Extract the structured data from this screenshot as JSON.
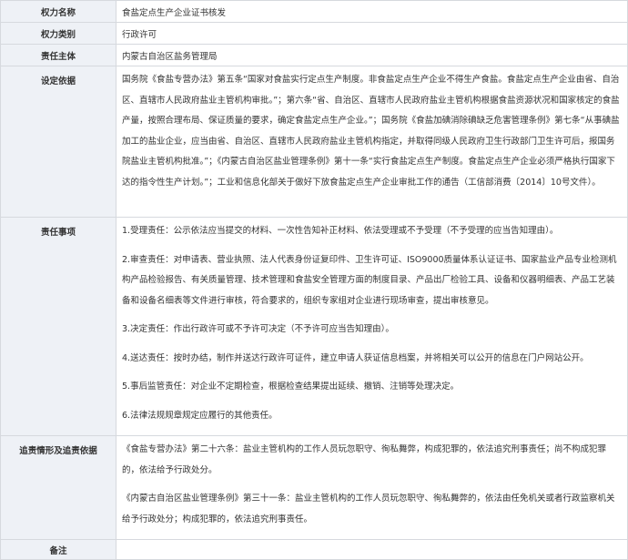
{
  "rows": {
    "power_name": {
      "label": "权力名称",
      "value": "食盐定点生产企业证书核发"
    },
    "power_category": {
      "label": "权力类别",
      "value": "行政许可"
    },
    "responsible_body": {
      "label": "责任主体",
      "value": "内蒙古自治区盐务管理局"
    },
    "legal_basis": {
      "label": "设定依据",
      "value": "国务院《食盐专营办法》第五条“国家对食盐实行定点生产制度。非食盐定点生产企业不得生产食盐。食盐定点生产企业由省、自治区、直辖市人民政府盐业主管机构审批。”；第六条“省、自治区、直辖市人民政府盐业主管机构根据食盐资源状况和国家核定的食盐产量，按照合理布局、保证质量的要求，确定食盐定点生产企业。”；国务院《食盐加碘消除碘缺乏危害管理条例》第七条“从事碘盐加工的盐业企业，应当由省、自治区、直辖市人民政府盐业主管机构指定，并取得同级人民政府卫生行政部门卫生许可后，报国务院盐业主管机构批准。”；《内蒙古自治区盐业管理条例》第十一条“实行食盐定点生产制度。食盐定点生产企业必须严格执行国家下达的指令性生产计划。”；工业和信息化部关于做好下放食盐定点生产企业审批工作的通告（工信部消费〔2014〕10号文件）。"
    },
    "responsibilities": {
      "label": "责任事项",
      "items": [
        "1.受理责任：公示依法应当提交的材料、一次性告知补正材料、依法受理或不予受理（不予受理的应当告知理由）。",
        "2.审查责任：对申请表、营业执照、法人代表身份证复印件、卫生许可证、ISO9000质量体系认证证书、国家盐业产品专业检测机构产品检验报告、有关质量管理、技术管理和食盐安全管理方面的制度目录、产品出厂检验工具、设备和仪器明细表、产品工艺装备和设备名细表等文件进行审核，符合要求的，组织专家组对企业进行现场审查，提出审核意见。",
        "3.决定责任：作出行政许可或不予许可决定（不予许可应当告知理由）。",
        "4.送达责任：按时办结，制作并送达行政许可证件，建立申请人获证信息档案，并将相关可以公开的信息在门户网站公开。",
        "5.事后监管责任：对企业不定期检查，根据检查结果提出延续、撤销、注销等处理决定。",
        "6.法律法规规章规定应履行的其他责任。"
      ]
    },
    "accountability": {
      "label": "追责情形及追责依据",
      "items": [
        "《食盐专营办法》第二十六条：盐业主管机构的工作人员玩忽职守、徇私舞弊，构成犯罪的，依法追究刑事责任；尚不构成犯罪的，依法给予行政处分。",
        "《内蒙古自治区盐业管理条例》第三十一条：盐业主管机构的工作人员玩忽职守、徇私舞弊的，依法由任免机关或者行政监察机关给予行政处分；构成犯罪的，依法追究刑事责任。"
      ]
    },
    "remarks": {
      "label": "备注",
      "value": ""
    }
  }
}
